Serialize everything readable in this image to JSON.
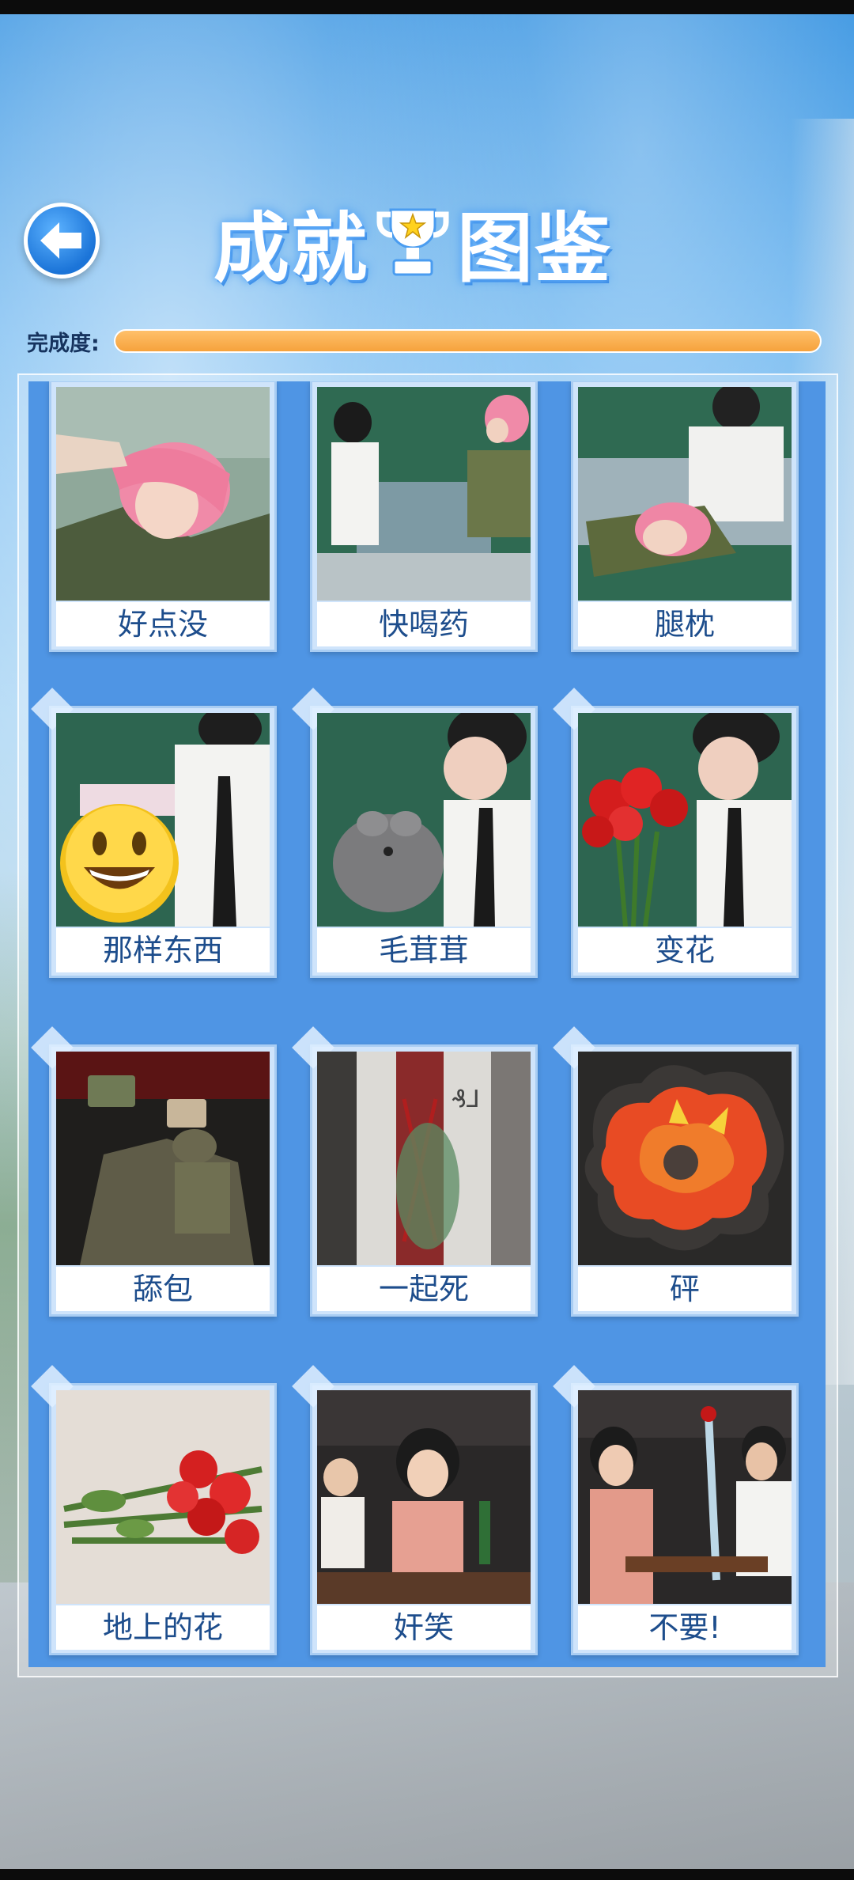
{
  "header": {
    "title_left": "成就",
    "title_right": "图鉴"
  },
  "progress": {
    "label": "完成度:",
    "value": 1.0
  },
  "colors": {
    "accent_blue": "#4f95e4",
    "progress_orange": "#f6a23c",
    "label_text": "#1d4d8c"
  },
  "achievements": [
    {
      "label": "好点没",
      "image": "pink-haired-girl-resting-photo"
    },
    {
      "label": "快喝药",
      "image": "boy-and-pink-haired-girl-on-sofa-photo"
    },
    {
      "label": "腿枕",
      "image": "girl-lying-on-boys-lap-photo"
    },
    {
      "label": "那样东西",
      "image": "boy-holding-cloth-smiley-emoji-photo"
    },
    {
      "label": "毛茸茸",
      "image": "boy-holding-plush-toy-photo"
    },
    {
      "label": "变花",
      "image": "boy-with-red-roses-photo"
    },
    {
      "label": "舔包",
      "image": "soldier-looting-game-photo"
    },
    {
      "label": "一起死",
      "image": "graffiti-wall-figure-photo"
    },
    {
      "label": "砰",
      "image": "explosion-cartoon-image"
    },
    {
      "label": "地上的花",
      "image": "roses-on-floor-photo"
    },
    {
      "label": "奸笑",
      "image": "woman-smirking-at-table-photo"
    },
    {
      "label": "不要!",
      "image": "woman-refusing-roses-photo"
    }
  ]
}
